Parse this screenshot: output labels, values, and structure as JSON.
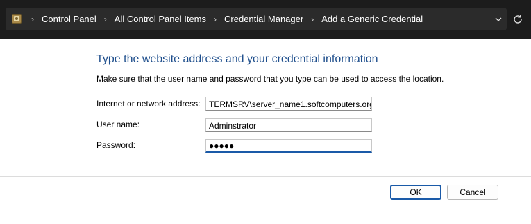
{
  "address_bar": {
    "breadcrumbs": [
      "Control Panel",
      "All Control Panel Items",
      "Credential Manager",
      "Add a Generic Credential"
    ]
  },
  "form": {
    "heading": "Type the website address and your credential information",
    "instruction": "Make sure that the user name and password that you type can be used to access the location.",
    "address_label": "Internet or network address:",
    "address_value": "TERMSRV\\server_name1.softcomputers.org",
    "username_label": "User name:",
    "username_value": "Adminstrator",
    "password_label": "Password:",
    "password_mask": "●●●●●"
  },
  "buttons": {
    "ok": "OK",
    "cancel": "Cancel"
  },
  "colors": {
    "heading": "#1e4e8c",
    "accent": "#1a5aa8",
    "addressbar_bg": "#1c1c1c"
  }
}
